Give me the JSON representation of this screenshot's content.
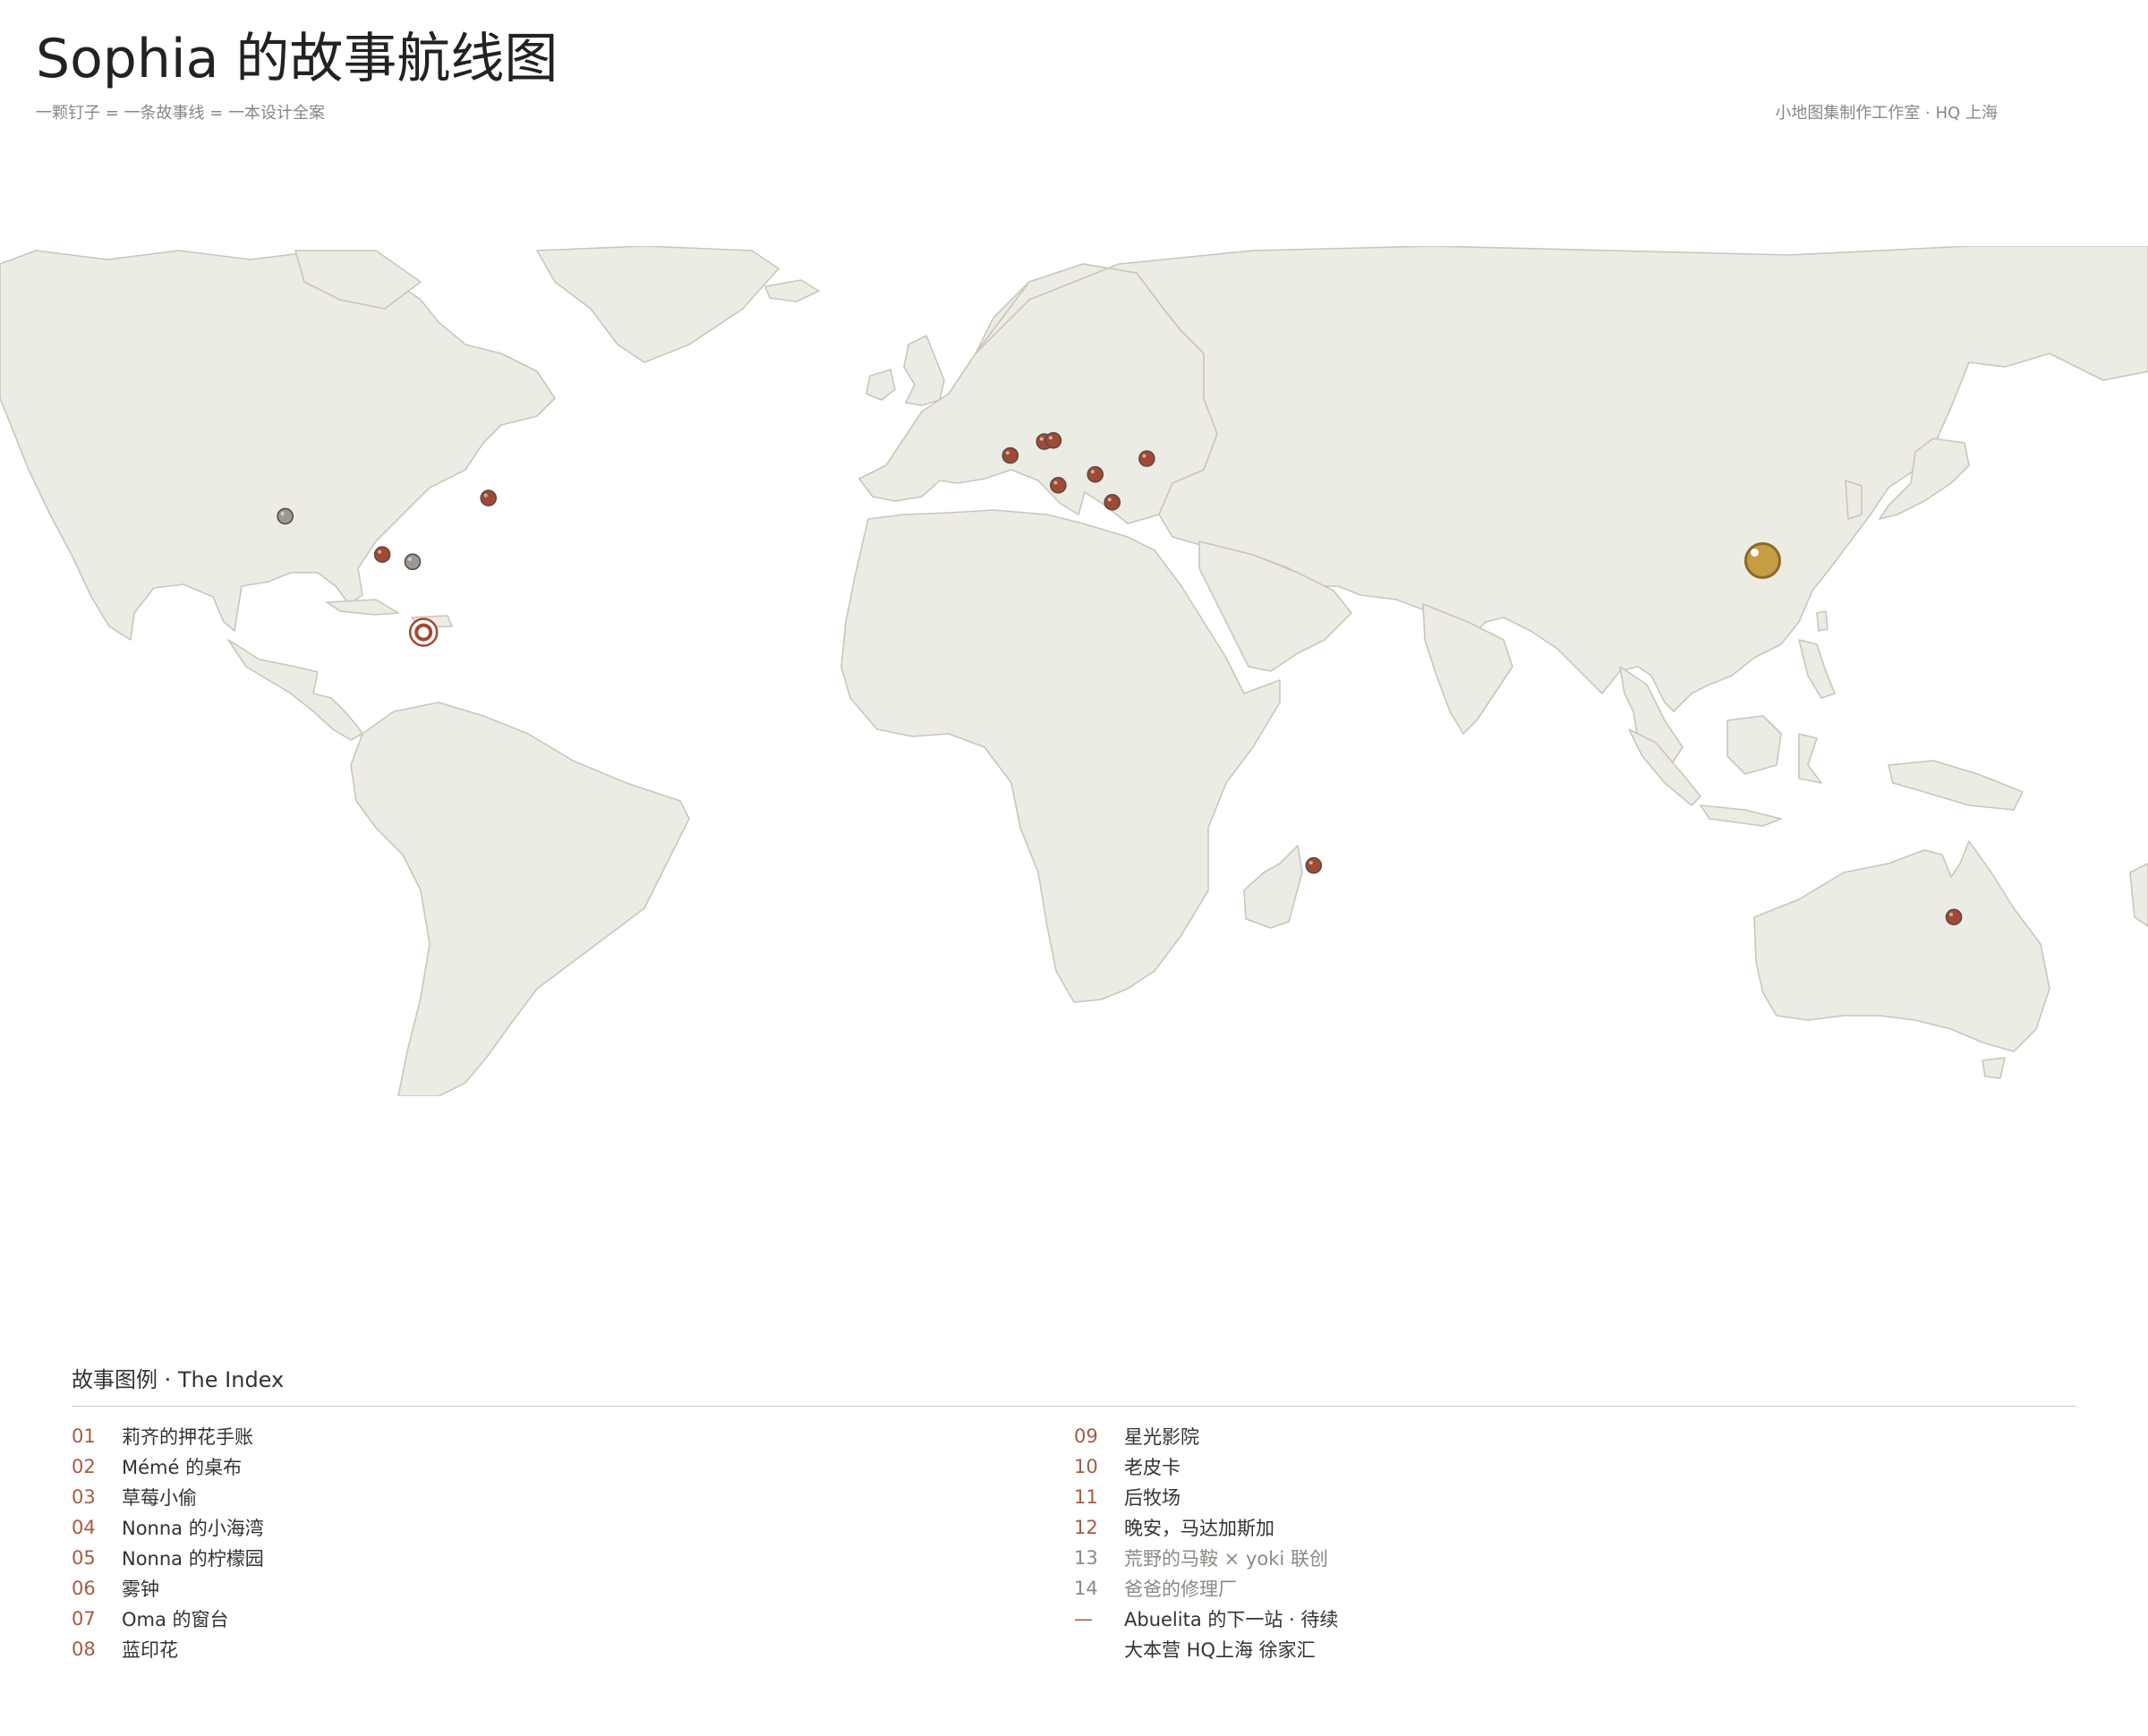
{
  "header": {
    "title": "Sophia 的故事航线图",
    "subtitle": "一颗钉子 = 一条故事线 = 一本设计全案",
    "credit": "小地图集制作工作室 · HQ 上海"
  },
  "colors": {
    "land": "#ecebe4",
    "land_border": "#c9c6bc",
    "pin": "#a04a36",
    "pin_pending": "#9b9994",
    "pin_hq": "#c69c45",
    "index_number": "#a55b45"
  },
  "map": {
    "pins": [
      {
        "id": "pin-west-usa",
        "lon": -122,
        "lat": 38.5,
        "kind": "pending"
      },
      {
        "id": "pin-midwest-usa",
        "lon": -88.5,
        "lat": 41.5,
        "kind": "story"
      },
      {
        "id": "pin-southwest-usa",
        "lon": -106,
        "lat": 32.2,
        "kind": "story"
      },
      {
        "id": "pin-texas-usa",
        "lon": -101,
        "lat": 31.0,
        "kind": "pending"
      },
      {
        "id": "pin-mexico",
        "lon": -99.2,
        "lat": 19.4,
        "kind": "next"
      },
      {
        "id": "pin-brittany",
        "lon": -2.5,
        "lat": 48.5,
        "kind": "story"
      },
      {
        "id": "pin-south-england-a",
        "lon": 3.1,
        "lat": 50.8,
        "kind": "story"
      },
      {
        "id": "pin-south-england-b",
        "lon": 4.6,
        "lat": 51.0,
        "kind": "story"
      },
      {
        "id": "pin-provence",
        "lon": 5.4,
        "lat": 43.6,
        "kind": "story"
      },
      {
        "id": "pin-alps",
        "lon": 11.5,
        "lat": 45.4,
        "kind": "story"
      },
      {
        "id": "pin-central-europe",
        "lon": 20.0,
        "lat": 48.0,
        "kind": "story"
      },
      {
        "id": "pin-naples",
        "lon": 14.3,
        "lat": 40.8,
        "kind": "story"
      },
      {
        "id": "pin-madagascar",
        "lon": 47.5,
        "lat": -19.0,
        "kind": "story"
      },
      {
        "id": "pin-shanghai-hq",
        "lon": 121.5,
        "lat": 31.2,
        "kind": "hq"
      },
      {
        "id": "pin-brisbane",
        "lon": 153.0,
        "lat": -27.5,
        "kind": "story"
      }
    ]
  },
  "legend": {
    "title": "故事图例 · The Index",
    "left": [
      {
        "num": "01",
        "label": "莉齐的押花手账"
      },
      {
        "num": "02",
        "label": "Mémé 的桌布"
      },
      {
        "num": "03",
        "label": "草莓小偷"
      },
      {
        "num": "04",
        "label": "Nonna 的小海湾"
      },
      {
        "num": "05",
        "label": "Nonna 的柠檬园"
      },
      {
        "num": "06",
        "label": "雾钟"
      },
      {
        "num": "07",
        "label": "Oma 的窗台"
      },
      {
        "num": "08",
        "label": "蓝印花"
      }
    ],
    "right": [
      {
        "num": "09",
        "label": "星光影院"
      },
      {
        "num": "10",
        "label": "老皮卡"
      },
      {
        "num": "11",
        "label": "后牧场"
      },
      {
        "num": "12",
        "label": "晚安，马达加斯加"
      },
      {
        "num": "13",
        "label": "荒野的马鞍 × yoki 联创"
      },
      {
        "num": "14",
        "label": "爸爸的修理厂"
      },
      {
        "num": "—",
        "label": "Abuelita 的下一站 · 待续"
      },
      {
        "num": "",
        "label": "大本营 HQ上海 徐家汇"
      }
    ]
  }
}
